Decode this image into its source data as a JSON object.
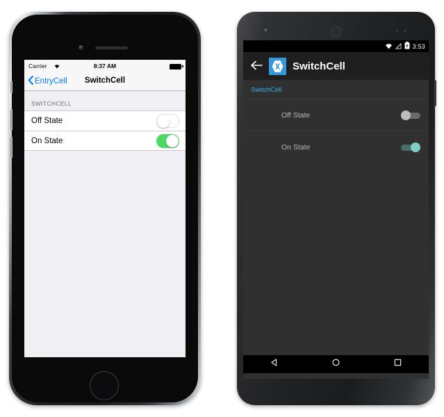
{
  "ios": {
    "status": {
      "carrier": "Carrier",
      "wifi_icon": "wifi-icon",
      "time": "8:37 AM",
      "battery_icon": "battery-full-icon"
    },
    "nav": {
      "back_chevron_icon": "chevron-left-icon",
      "back_label": "EntryCell",
      "title": "SwitchCell"
    },
    "section_header": "SWITCHCELL",
    "rows": [
      {
        "label": "Off State",
        "switch_state": "off",
        "switch_name": "switch-off-state"
      },
      {
        "label": "On State",
        "switch_state": "on",
        "switch_name": "switch-on-state"
      }
    ],
    "colors": {
      "tint": "#007aff",
      "switch_on": "#4cd964",
      "background": "#efeff4",
      "row_background": "#ffffff"
    }
  },
  "android": {
    "status": {
      "wifi_icon": "wifi-icon",
      "signal_icon": "signal-off-icon",
      "battery_icon": "battery-charging-icon",
      "time": "3:53"
    },
    "actionbar": {
      "back_icon": "arrow-left-icon",
      "logo_icon": "xamarin-logo-icon",
      "title": "SwitchCell"
    },
    "section_header": "SwitchCell",
    "rows": [
      {
        "label": "Off State",
        "switch_state": "off",
        "switch_name": "switch-off-state"
      },
      {
        "label": "On State",
        "switch_state": "on",
        "switch_name": "switch-on-state"
      }
    ],
    "navbar": {
      "back_icon": "triangle-back-icon",
      "home_icon": "circle-home-icon",
      "recents_icon": "square-recents-icon"
    },
    "colors": {
      "accent": "#33b5e5",
      "switch_on_thumb": "#80cbc4",
      "logo_blue": "#3498db",
      "background": "#303030",
      "actionbar": "#1f1f1f"
    }
  }
}
